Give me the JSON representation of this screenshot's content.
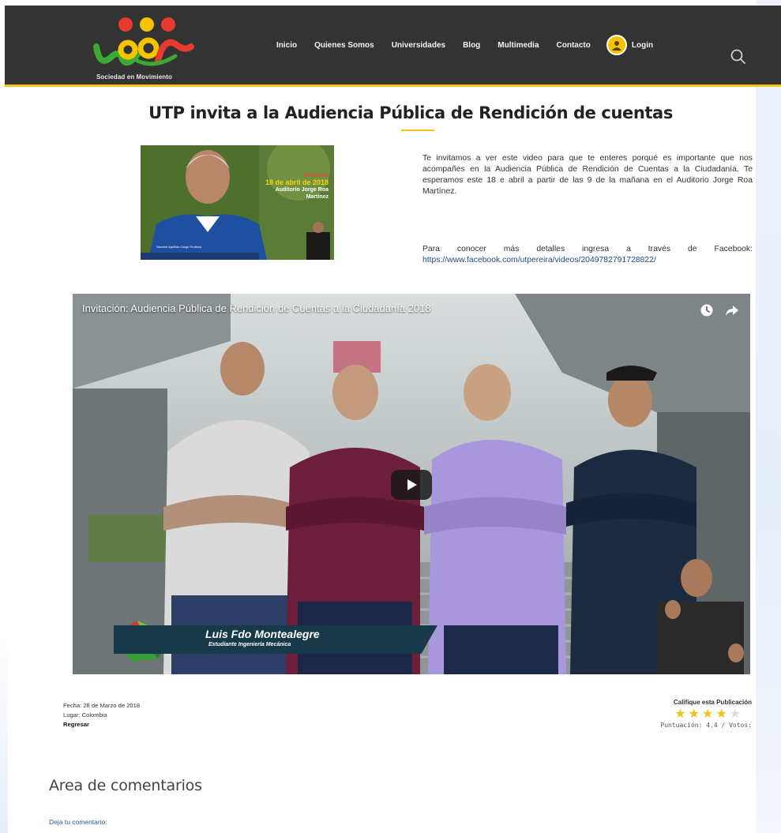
{
  "header": {
    "logo_tagline": "Sociedad en Movimiento",
    "nav": [
      "Inicio",
      "Quienes Somos",
      "Universidades",
      "Blog",
      "Multimedia",
      "Contacto"
    ],
    "login_label": "Login"
  },
  "article": {
    "title": "UTP invita a la Audiencia Pública de Rendición de cuentas",
    "thumbnail": {
      "overlay_line1": "Invitación",
      "overlay_date": "18 de abril de 2018",
      "overlay_line3": "Auditorio Jorge Roa Martínez",
      "caption": "Nombre Apellido Cargo Profesor"
    },
    "intro": "Te invitamos a ver este video para que te enteres porqué es importante que nos acompañes en la Audiencia Pública de Rendición de Cuentas a la Ciudadanía. Te esperamos este 18 e abril a partir de las 9 de la mañana en el Auditorio Jorge Roa Martínez.",
    "facebook_text": "Para conocer más detalles ingresa a través de Facebook:",
    "facebook_url": "https://www.facebook.com/utpereira/videos/2049782791728822/"
  },
  "video": {
    "title": "Invitación: Audiencia Pública de Rendición de Cuentas a la Ciudadanía 2018",
    "lower_third_name": "Luis Fdo Montealegre",
    "lower_third_role": "Estudiante Ingeniería Mecánica"
  },
  "meta": {
    "date": "Fecha: 28 de Marzo de 2018",
    "place": "Lugar: Colombia",
    "back": "Regresar"
  },
  "rating": {
    "title": "Califique esta Publicación",
    "score_text": "Puntuación: 4.4 / Votos:",
    "score": 4.4,
    "max": 5,
    "star_color": "#f1c21a"
  },
  "comments": {
    "title": "Area de comentarios",
    "leave_comment": "Deja tu comentario:"
  },
  "colors": {
    "header_bg": "#333333",
    "accent": "#f0c419",
    "link": "#1f4a86"
  }
}
